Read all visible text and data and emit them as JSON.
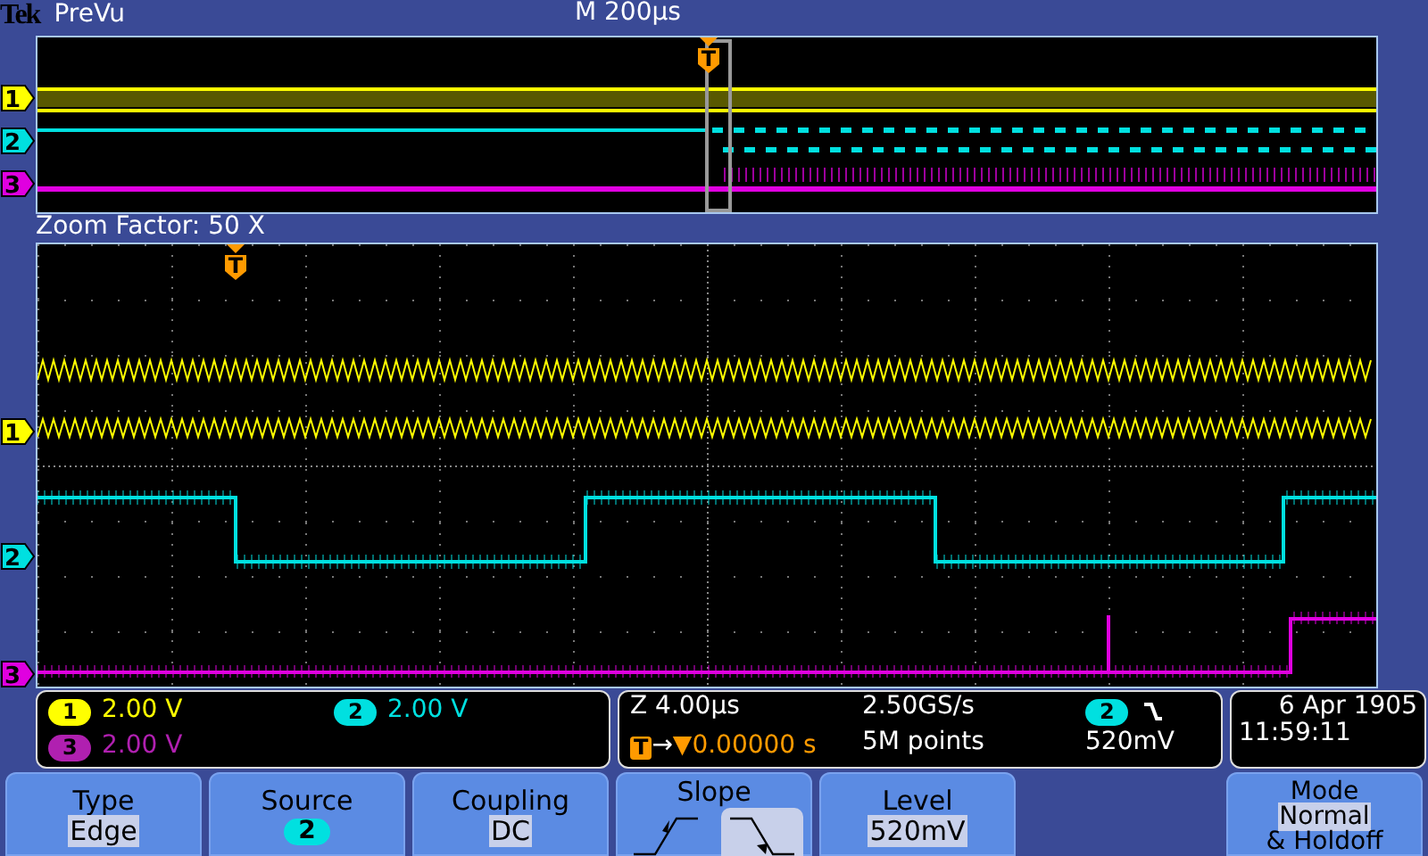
{
  "header": {
    "brand": "Tek",
    "mode": "PreVu",
    "timebase": "M 200µs"
  },
  "preview": {
    "trigger_marker": "T",
    "channel_markers": [
      {
        "label": "1",
        "color": "#ffff00"
      },
      {
        "label": "2",
        "color": "#00e0e0"
      },
      {
        "label": "3",
        "color": "#e000e0"
      }
    ]
  },
  "zoom_factor": "Zoom Factor: 50 X",
  "main": {
    "trigger_marker": "T",
    "channel_markers": [
      {
        "label": "1",
        "color": "#ffff00"
      },
      {
        "label": "2",
        "color": "#00e0e0"
      },
      {
        "label": "3",
        "color": "#e000e0"
      }
    ]
  },
  "channel_readouts": [
    {
      "channel": "1",
      "scale": "2.00 V",
      "color": "#ffff00"
    },
    {
      "channel": "2",
      "scale": "2.00 V",
      "color": "#00e0e0"
    },
    {
      "channel": "3",
      "scale": "2.00 V",
      "color": "#b020b0"
    }
  ],
  "horizontal": {
    "zoom_scale": "Z 4.00µs",
    "trigger_marker": "T",
    "arrow": "→",
    "position": "▼0.00000 s",
    "sample_rate": "2.50GS/s",
    "record_length": "5M points",
    "trigger_source": "2",
    "trigger_level": "520mV"
  },
  "clock": {
    "date": "6 Apr 1905",
    "time": "11:59:11"
  },
  "menu": [
    {
      "kind": "value",
      "label": "Type",
      "value": "Edge"
    },
    {
      "kind": "channel",
      "label": "Source",
      "value": "2",
      "color": "#00e0e0"
    },
    {
      "kind": "value",
      "label": "Coupling",
      "value": "DC"
    },
    {
      "kind": "slope",
      "label": "Slope",
      "options": [
        {
          "selected": false
        },
        {
          "selected": true
        }
      ]
    },
    {
      "kind": "value",
      "label": "Level",
      "value": "520mV"
    }
  ],
  "mode_button": {
    "label": "Mode",
    "value": "Normal",
    "extra": "& Holdoff"
  }
}
